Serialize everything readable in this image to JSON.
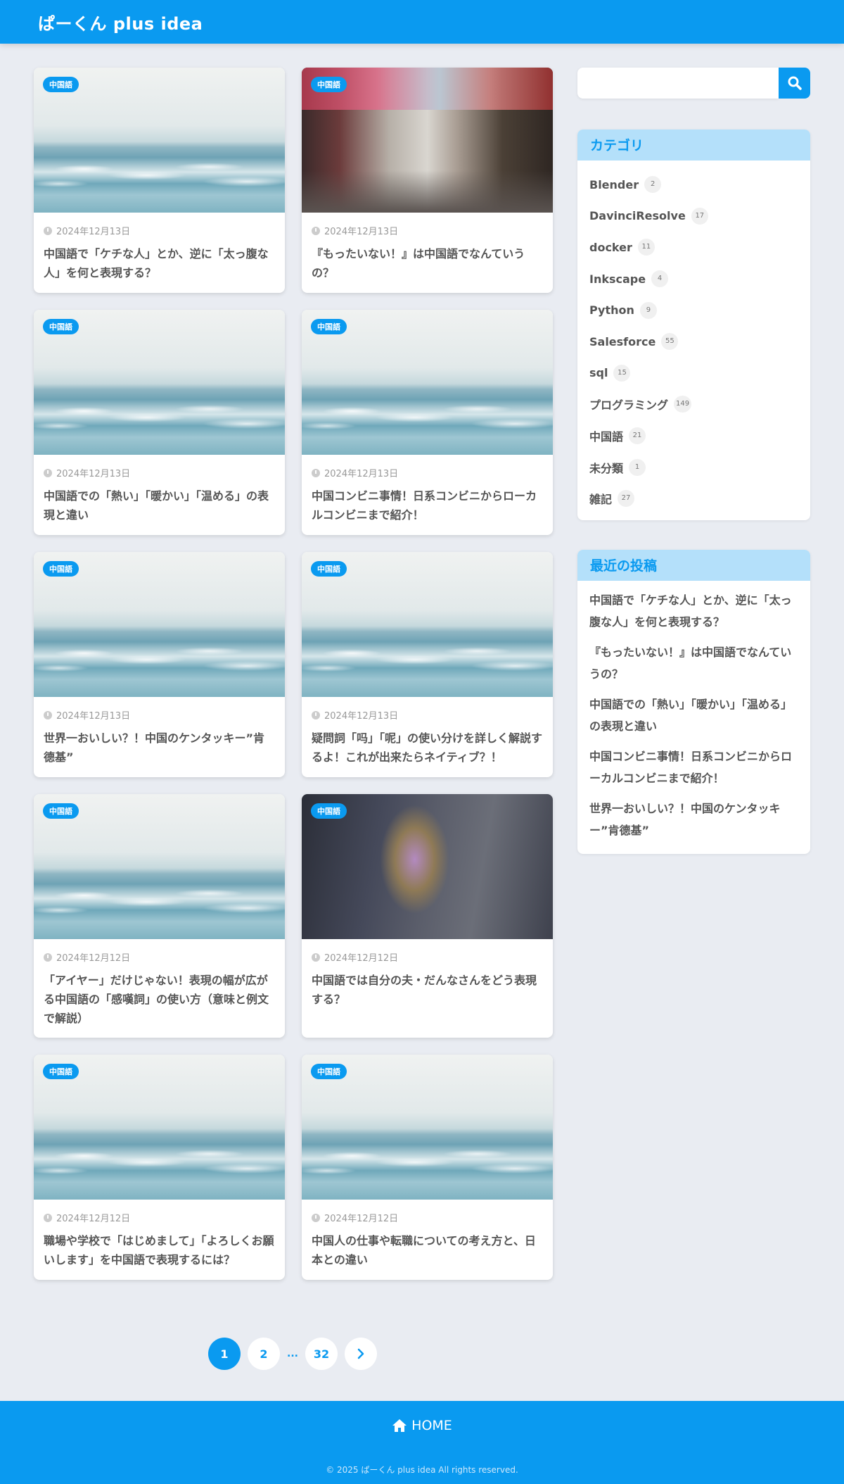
{
  "site": {
    "title": "ぱーくん plus idea"
  },
  "posts": [
    {
      "category": "中国語",
      "date": "2024年12月13日",
      "title": "中国語で「ケチな人」とか、逆に「太っ腹な人」を何と表現する？",
      "image": "sea"
    },
    {
      "category": "中国語",
      "date": "2024年12月13日",
      "title": "『もったいない！』は中国語でなんていうの？",
      "image": "street"
    },
    {
      "category": "中国語",
      "date": "2024年12月13日",
      "title": "中国語での「熱い」「暖かい」「温める」の表現と違い",
      "image": "sea"
    },
    {
      "category": "中国語",
      "date": "2024年12月13日",
      "title": "中国コンビニ事情！日系コンビニからローカルコンビニまで紹介！",
      "image": "sea"
    },
    {
      "category": "中国語",
      "date": "2024年12月13日",
      "title": "世界一おいしい？！中国のケンタッキー”肯德基”",
      "image": "sea"
    },
    {
      "category": "中国語",
      "date": "2024年12月13日",
      "title": "疑問詞「吗」「呢」の使い分けを詳しく解説するよ！これが出来たらネイティブ？！",
      "image": "sea"
    },
    {
      "category": "中国語",
      "date": "2024年12月12日",
      "title": "「アイヤー」だけじゃない！表現の幅が広がる中国語の「感嘆詞」の使い方（意味と例文で解説）",
      "image": "sea"
    },
    {
      "category": "中国語",
      "date": "2024年12月12日",
      "title": "中国語では自分の夫・だんなさんをどう表現する？",
      "image": "suit"
    },
    {
      "category": "中国語",
      "date": "2024年12月12日",
      "title": "職場や学校で「はじめまして」「よろしくお願いします」を中国語で表現するには？",
      "image": "sea"
    },
    {
      "category": "中国語",
      "date": "2024年12月12日",
      "title": "中国人の仕事や転職についての考え方と、日本との違い",
      "image": "sea"
    }
  ],
  "search": {
    "placeholder": "",
    "icon": "search-icon"
  },
  "categories": {
    "title": "カテゴリ",
    "items": [
      {
        "label": "Blender",
        "count": "2"
      },
      {
        "label": "DavinciResolve",
        "count": "17"
      },
      {
        "label": "docker",
        "count": "11"
      },
      {
        "label": "Inkscape",
        "count": "4"
      },
      {
        "label": "Python",
        "count": "9"
      },
      {
        "label": "Salesforce",
        "count": "55"
      },
      {
        "label": "sql",
        "count": "15"
      },
      {
        "label": "プログラミング",
        "count": "149"
      },
      {
        "label": "中国語",
        "count": "21"
      },
      {
        "label": "未分類",
        "count": "1"
      },
      {
        "label": "雑記",
        "count": "27"
      }
    ]
  },
  "recent": {
    "title": "最近の投稿",
    "items": [
      "中国語で「ケチな人」とか、逆に「太っ腹な人」を何と表現する？",
      "『もったいない！』は中国語でなんていうの？",
      "中国語での「熱い」「暖かい」「温める」の表現と違い",
      "中国コンビニ事情！日系コンビニからローカルコンビニまで紹介！",
      "世界一おいしい？！中国のケンタッキー”肯德基”"
    ]
  },
  "pagination": {
    "current": "1",
    "next": "2",
    "dots": "...",
    "last": "32"
  },
  "footer": {
    "home": "HOME",
    "copyright": "© 2025 ぱーくん plus idea All rights reserved."
  },
  "colors": {
    "accent": "#0a9af0",
    "widget_header": "#b4e0fa",
    "background": "#e9ecf2"
  }
}
